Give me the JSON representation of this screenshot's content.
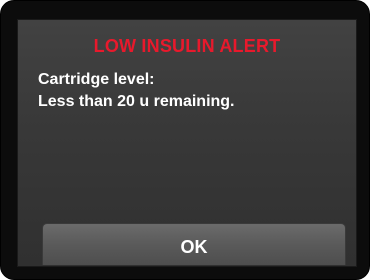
{
  "alert": {
    "title": "LOW INSULIN ALERT",
    "message_line_1": "Cartridge level:",
    "message_line_2": "Less than 20 u remaining.",
    "ok_label": "OK"
  },
  "colors": {
    "title": "#e8192c",
    "text": "#ffffff",
    "screen_background": "#3a3a3a",
    "button_background": "#5e5e5e",
    "frame": "#0c0c0c"
  }
}
